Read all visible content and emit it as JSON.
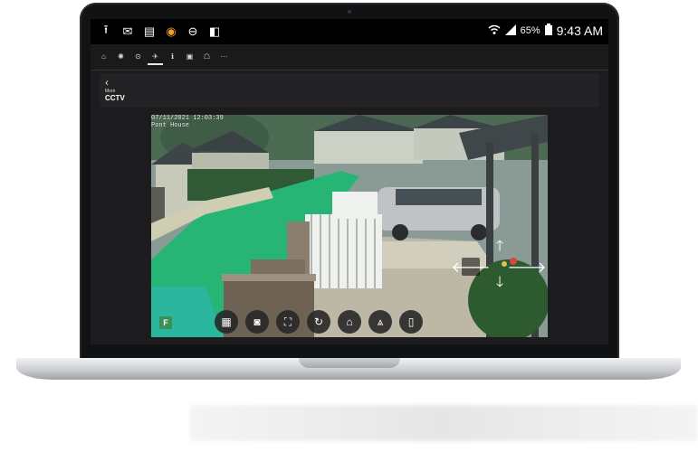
{
  "statusbar": {
    "left_icons": [
      "upload-icon",
      "mail-icon",
      "sim-icon",
      "app-orange-icon",
      "blocked-icon",
      "shopping-bag-icon"
    ],
    "battery": "65%",
    "time": "9:43 AM"
  },
  "nav": {
    "tabs": [
      "home-icon",
      "lights-icon",
      "media-icon",
      "security-icon",
      "climate-icon",
      "calendar-icon",
      "camera-icon",
      "more-icon"
    ]
  },
  "header": {
    "back": "‹",
    "subtitle": "More",
    "title": "CCTV"
  },
  "video": {
    "timestamp": "07/11/2021 12:03:39",
    "camera_name": "Pont House",
    "flag_label": "F"
  },
  "controls": [
    "film-icon",
    "camera-icon",
    "fullscreen-icon",
    "refresh-icon",
    "gate-icon",
    "road-icon",
    "phone-icon"
  ],
  "colors": {
    "device_frame": "#111214",
    "screen_bg": "#1c1c1e",
    "lawn_green": "#26b574",
    "status_orange": "#f4a12a"
  }
}
